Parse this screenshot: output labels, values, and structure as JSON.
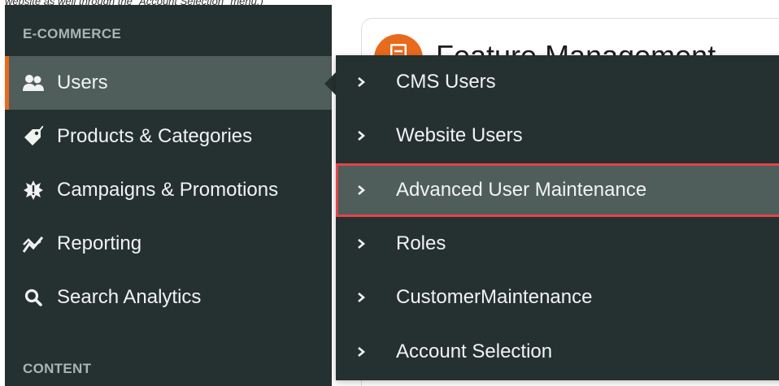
{
  "caption": "website as well through the \"Account Selection\" menu.)",
  "background": {
    "title": "Feature Management",
    "icon": "document-icon"
  },
  "sidebar": {
    "sections": [
      {
        "label": "E-COMMERCE"
      },
      {
        "label": "CONTENT"
      }
    ],
    "items": [
      {
        "label": "Users",
        "icon": "users-icon",
        "active": true
      },
      {
        "label": "Products & Categories",
        "icon": "tag-icon"
      },
      {
        "label": "Campaigns & Promotions",
        "icon": "burst-badge-icon"
      },
      {
        "label": "Reporting",
        "icon": "chart-line-icon"
      },
      {
        "label": "Search Analytics",
        "icon": "search-icon"
      }
    ]
  },
  "flyout": {
    "items": [
      {
        "label": "CMS Users"
      },
      {
        "label": "Website Users"
      },
      {
        "label": "Advanced User Maintenance",
        "highlighted": true
      },
      {
        "label": "Roles"
      },
      {
        "label": "CustomerMaintenance"
      },
      {
        "label": "Account Selection"
      }
    ]
  },
  "colors": {
    "sidebar_bg": "#253130",
    "active_bg": "#4f5d5b",
    "accent": "#e86a1c",
    "highlight_border": "#e0454a"
  }
}
